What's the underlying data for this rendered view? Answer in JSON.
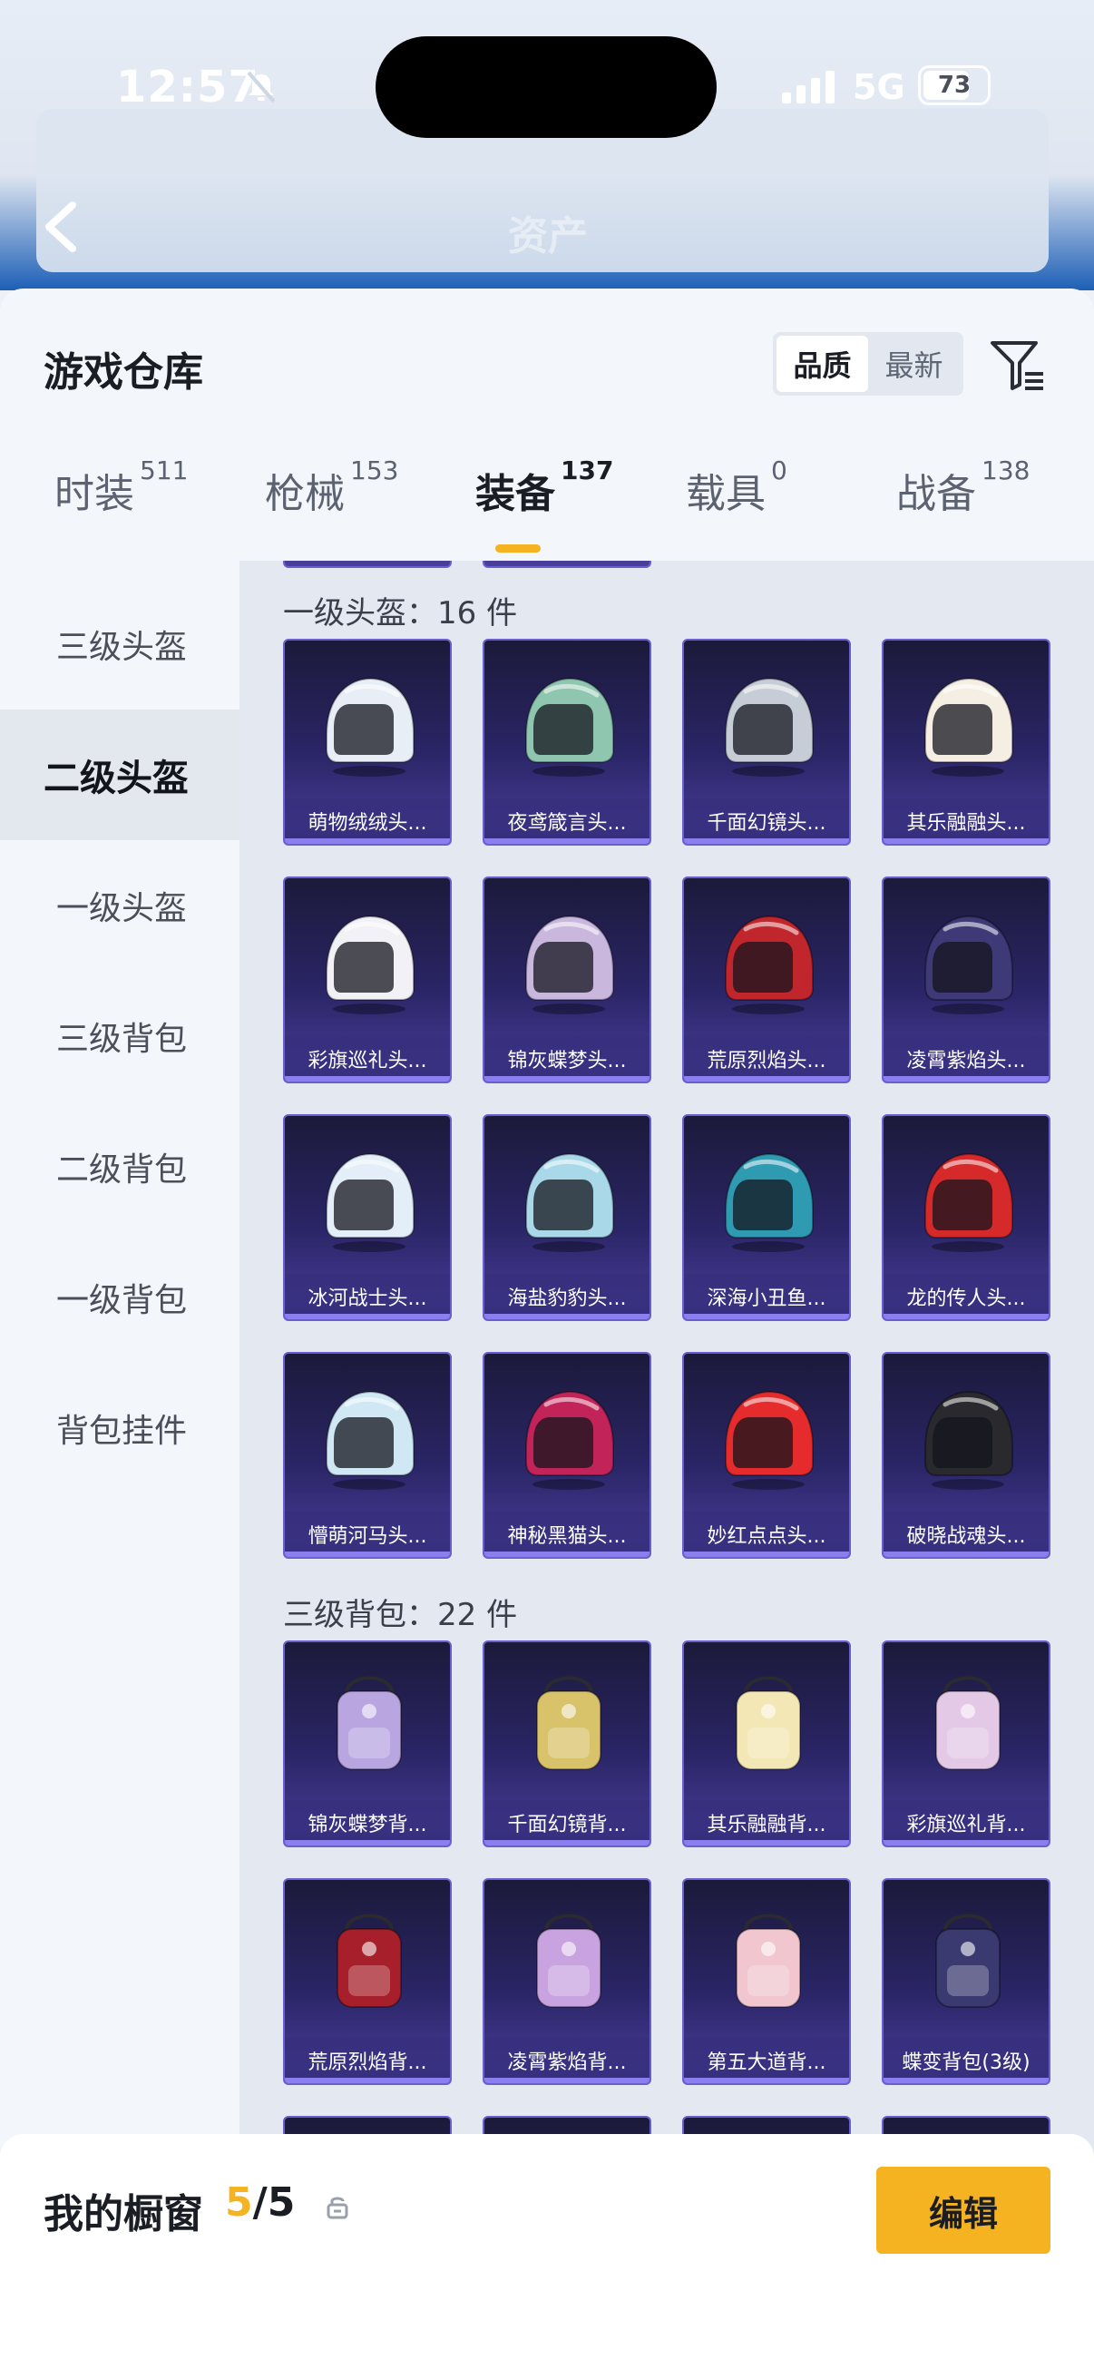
{
  "status_bar": {
    "time": "12:57",
    "network": "5G",
    "battery": "73",
    "battery_level": 0.73
  },
  "header": {
    "title": "资产"
  },
  "sheet": {
    "title": "游戏仓库",
    "sort_options": [
      "品质",
      "最新"
    ],
    "sort_selected": "品质"
  },
  "tabs": [
    {
      "label": "时装",
      "count": "511"
    },
    {
      "label": "枪械",
      "count": "153"
    },
    {
      "label": "装备",
      "count": "137"
    },
    {
      "label": "载具",
      "count": "0"
    },
    {
      "label": "战备",
      "count": "138"
    }
  ],
  "active_tab": "装备",
  "sidebar": {
    "items": [
      {
        "label": "三级头盔"
      },
      {
        "label": "二级头盔"
      },
      {
        "label": "一级头盔"
      },
      {
        "label": "三级背包"
      },
      {
        "label": "二级背包"
      },
      {
        "label": "一级背包"
      },
      {
        "label": "背包挂件"
      }
    ],
    "active": "二级头盔"
  },
  "sections": [
    {
      "title": "一级头盔：16 件",
      "items": [
        {
          "name": "萌物绒绒头...",
          "icon": "helmet-icon",
          "color": "#e8eef5"
        },
        {
          "name": "夜鸢箴言头...",
          "icon": "helmet-icon",
          "color": "#8fc6b0"
        },
        {
          "name": "千面幻镜头...",
          "icon": "helmet-icon",
          "color": "#c7cdd6"
        },
        {
          "name": "其乐融融头...",
          "icon": "helmet-icon",
          "color": "#f4efe2"
        },
        {
          "name": "彩旗巡礼头...",
          "icon": "helmet-icon",
          "color": "#f2f2f6"
        },
        {
          "name": "锦灰蝶梦头...",
          "icon": "helmet-icon",
          "color": "#c9b7de"
        },
        {
          "name": "荒原烈焰头...",
          "icon": "helmet-icon",
          "color": "#c0262c"
        },
        {
          "name": "凌霄紫焰头...",
          "icon": "helmet-icon",
          "color": "#3e3a78"
        },
        {
          "name": "冰河战士头...",
          "icon": "helmet-icon",
          "color": "#e3eef8"
        },
        {
          "name": "海盐豹豹头...",
          "icon": "helmet-icon",
          "color": "#a9d9e8"
        },
        {
          "name": "深海小丑鱼...",
          "icon": "helmet-icon",
          "color": "#2f9bb3"
        },
        {
          "name": "龙的传人头...",
          "icon": "helmet-icon",
          "color": "#d62a2a"
        },
        {
          "name": "懵萌河马头...",
          "icon": "helmet-icon",
          "color": "#cfe8f4"
        },
        {
          "name": "神秘黑猫头...",
          "icon": "helmet-icon",
          "color": "#c2245a"
        },
        {
          "name": "妙红点点头...",
          "icon": "helmet-icon",
          "color": "#e52b2b"
        },
        {
          "name": "破晓战魂头...",
          "icon": "helmet-icon",
          "color": "#2a2a2e"
        }
      ]
    },
    {
      "title": "三级背包：22 件",
      "items": [
        {
          "name": "锦灰蝶梦背...",
          "icon": "backpack-icon",
          "color": "#b9a6e0"
        },
        {
          "name": "千面幻镜背...",
          "icon": "backpack-icon",
          "color": "#d8c26a"
        },
        {
          "name": "其乐融融背...",
          "icon": "backpack-icon",
          "color": "#f3e7b5"
        },
        {
          "name": "彩旗巡礼背...",
          "icon": "backpack-icon",
          "color": "#e3c9e6"
        },
        {
          "name": "荒原烈焰背...",
          "icon": "backpack-icon",
          "color": "#a61f2a"
        },
        {
          "name": "凌霄紫焰背...",
          "icon": "backpack-icon",
          "color": "#c9a3e0"
        },
        {
          "name": "第五大道背...",
          "icon": "backpack-icon",
          "color": "#f1c6cf"
        },
        {
          "name": "蝶变背包(3级)",
          "icon": "backpack-icon",
          "color": "#3a3a70"
        }
      ]
    }
  ],
  "my_window": {
    "label": "我的橱窗",
    "current": "5",
    "separator": "/",
    "total": "5"
  },
  "edit_label": "编辑",
  "colors": {
    "accent": "#f5b321",
    "card_border": "#6a5fd0"
  }
}
